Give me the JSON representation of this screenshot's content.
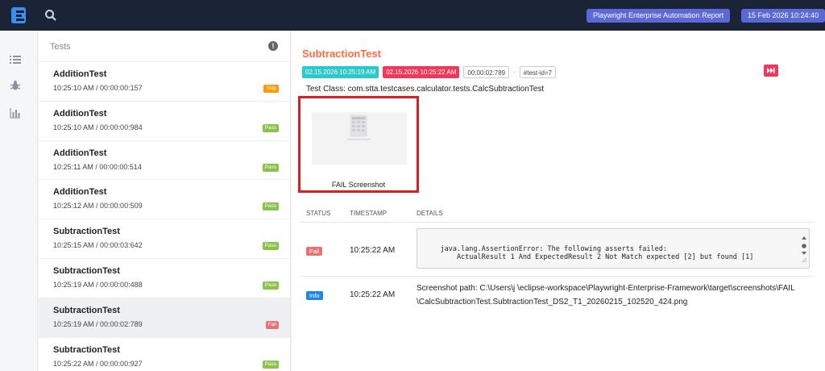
{
  "header": {
    "report_title": "Playwright Enterprise Automation Report",
    "report_date": "15 Feb 2026 10:24:40",
    "colors": {
      "bar": "#1b2437",
      "badge": "#5b69d6"
    }
  },
  "nav_icons": [
    "list-icon",
    "bug-icon",
    "bar-chart-icon"
  ],
  "tests_panel": {
    "title": "Tests",
    "items": [
      {
        "name": "AdditionTest",
        "time": "10:25:10 AM / 00:00:00:157",
        "status": "Skip"
      },
      {
        "name": "AdditionTest",
        "time": "10:25:10 AM / 00:00:00:984",
        "status": "Pass"
      },
      {
        "name": "AdditionTest",
        "time": "10:25:11 AM / 00:00:00:514",
        "status": "Pass"
      },
      {
        "name": "AdditionTest",
        "time": "10:25:12 AM / 00:00:00:509",
        "status": "Pass"
      },
      {
        "name": "SubtractionTest",
        "time": "10:25:15 AM / 00:00:03:642",
        "status": "Pass"
      },
      {
        "name": "SubtractionTest",
        "time": "10:25:19 AM / 00:00:00:488",
        "status": "Pass"
      },
      {
        "name": "SubtractionTest",
        "time": "10:25:19 AM / 00:00:02:789",
        "status": "Fail"
      },
      {
        "name": "SubtractionTest",
        "time": "10:25:22 AM / 00:00:00:927",
        "status": "Pass"
      }
    ]
  },
  "detail": {
    "title": "SubtractionTest",
    "start_time": "02.15.2026 10:25:19 AM",
    "end_time": "02.15.2026 10:25:22 AM",
    "duration": "00:00:02:789",
    "separator": "·",
    "test_id": "#test-id=7",
    "test_class": "Test Class: com.stta.testcases.calculator.tests.CalcSubtractionTest",
    "screenshot_caption": "FAIL Screenshot",
    "log_columns": {
      "status": "STATUS",
      "timestamp": "TIMESTAMP",
      "details": "DETAILS"
    },
    "logs": [
      {
        "status": "Fail",
        "timestamp": "10:25:22 AM",
        "details": "java.lang.AssertionError: The following asserts failed:\n        ActualResult 1 And ExpectedResult 2 Not Match expected [2] but found [1]"
      },
      {
        "status": "Info",
        "timestamp": "10:25:22 AM",
        "line1": "Screenshot path: C:\\Users\\j          \\eclipse-workspace\\Playwright-Enterprise-Framework\\target\\screenshots\\FAIL",
        "line2": "\\CalcSubtractionTest.SubtractionTest_DS2_T1_20260215_102520_424.png"
      }
    ]
  }
}
